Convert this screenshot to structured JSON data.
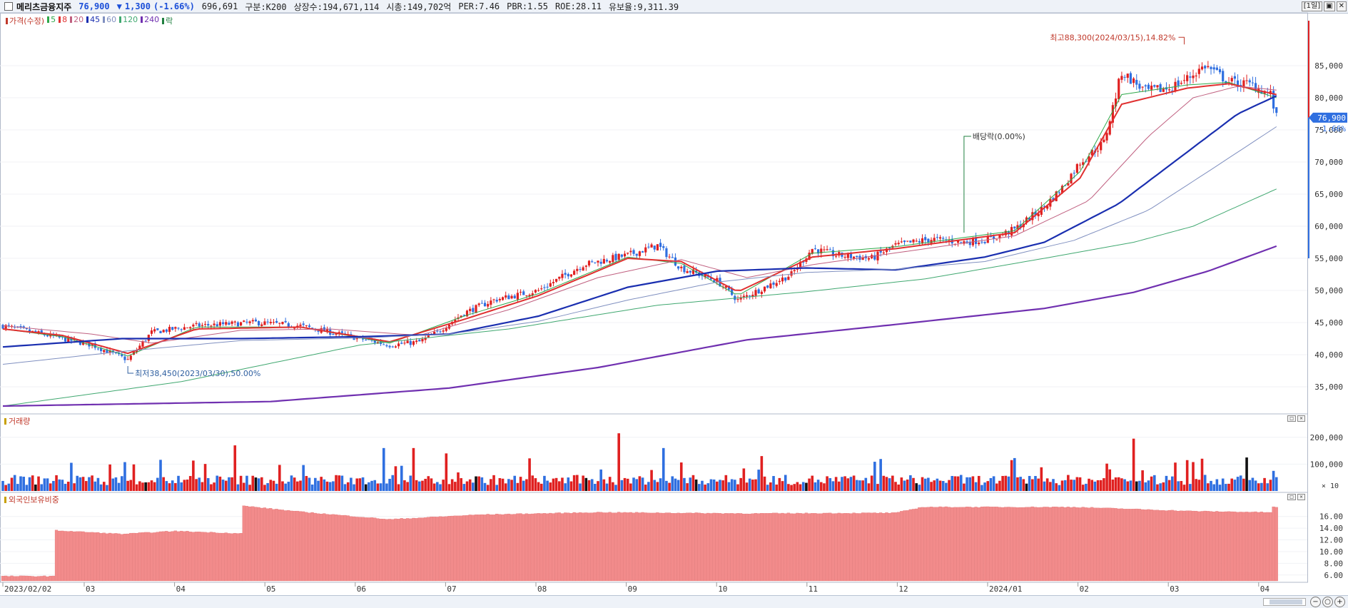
{
  "header": {
    "stock_name": "메리츠금융지주",
    "price": "76,900",
    "change_arrow": "▼",
    "change": "1,300",
    "change_pct": "(-1.66%)",
    "volume": "696,691",
    "segment": "구분:K200",
    "listed_shares": "상장수:194,671,114",
    "market_cap": "시총:149,702억",
    "per": "PER:7.46",
    "pbr": "PBR:1.55",
    "roe": "ROE:28.11",
    "reserve_ratio": "유보율:9,311.39",
    "period_button": "[1일]",
    "btn_restore": "▣",
    "btn_close": "✕"
  },
  "legend": [
    {
      "label": "가격(수정)",
      "color": "#c0392b"
    },
    {
      "label": "5",
      "color": "#2ea84a"
    },
    {
      "label": "8",
      "color": "#e03030"
    },
    {
      "label": "20",
      "color": "#c06080"
    },
    {
      "label": "45",
      "color": "#1a2fb0"
    },
    {
      "label": "60",
      "color": "#8090c0"
    },
    {
      "label": "120",
      "color": "#40a870"
    },
    {
      "label": "240",
      "color": "#7030b0"
    },
    {
      "label": "락",
      "color": "#208040"
    }
  ],
  "panels": {
    "volume_label": "거래량",
    "foreign_label": "외국인보유비중",
    "volume_unit": "× 10"
  },
  "annotations": {
    "high": "최고88,300(2024/03/15),14.82%",
    "low": "최저38,450(2023/03/30),50.00%",
    "dividend": "배당락(0.00%)",
    "last_price": "76,900",
    "last_change": "-1.66%"
  },
  "colors": {
    "up": "#e02020",
    "down": "#2f6fe0",
    "neutral": "#111111",
    "foreign_bar": "#f28b8b"
  },
  "chart_data": {
    "type": "candlestick",
    "x_tick_labels": [
      "2023/02/02",
      "03",
      "04",
      "05",
      "06",
      "07",
      "08",
      "09",
      "10",
      "11",
      "12",
      "2024/01",
      "02",
      "03",
      "04"
    ],
    "price_axis_ticks": [
      "85,000",
      "80,000",
      "75,000",
      "70,000",
      "65,000",
      "60,000",
      "55,000",
      "50,000",
      "45,000",
      "40,000",
      "35,000"
    ],
    "price_range": [
      31000,
      93000
    ],
    "volume_axis_ticks": [
      "200,000",
      "100,000"
    ],
    "volume_range": [
      0,
      250000
    ],
    "foreign_axis_ticks": [
      "16.00",
      "14.00",
      "12.00",
      "10.00",
      "8.00",
      "6.00"
    ],
    "foreign_range": [
      5.0,
      18.4
    ],
    "price_trend": [
      [
        0,
        44500
      ],
      [
        20,
        42500
      ],
      [
        30,
        41500
      ],
      [
        42,
        39200
      ],
      [
        50,
        43500
      ],
      [
        65,
        44500
      ],
      [
        85,
        45000
      ],
      [
        100,
        44500
      ],
      [
        110,
        43500
      ],
      [
        120,
        42500
      ],
      [
        130,
        41500
      ],
      [
        140,
        42000
      ],
      [
        146,
        43500
      ],
      [
        155,
        46500
      ],
      [
        165,
        48500
      ],
      [
        180,
        50000
      ],
      [
        195,
        54000
      ],
      [
        210,
        55500
      ],
      [
        220,
        57000
      ],
      [
        228,
        53500
      ],
      [
        240,
        51500
      ],
      [
        247,
        48500
      ],
      [
        256,
        50500
      ],
      [
        265,
        52500
      ],
      [
        272,
        56500
      ],
      [
        280,
        55500
      ],
      [
        292,
        55000
      ],
      [
        300,
        57000
      ],
      [
        312,
        58000
      ],
      [
        322,
        57500
      ],
      [
        332,
        58000
      ],
      [
        340,
        59500
      ],
      [
        350,
        63000
      ],
      [
        356,
        66000
      ],
      [
        362,
        70000
      ],
      [
        370,
        73000
      ],
      [
        376,
        84000
      ],
      [
        384,
        81000
      ],
      [
        392,
        81500
      ],
      [
        398,
        83000
      ],
      [
        404,
        85000
      ],
      [
        412,
        82500
      ],
      [
        420,
        82000
      ],
      [
        426,
        80500
      ],
      [
        428,
        76900
      ]
    ],
    "ma_trends": {
      "ma5": [
        [
          0,
          44000
        ],
        [
          20,
          42800
        ],
        [
          42,
          39800
        ],
        [
          65,
          44300
        ],
        [
          100,
          44300
        ],
        [
          130,
          41800
        ],
        [
          155,
          46000
        ],
        [
          180,
          49500
        ],
        [
          210,
          55200
        ],
        [
          228,
          54200
        ],
        [
          247,
          49200
        ],
        [
          272,
          55800
        ],
        [
          300,
          56800
        ],
        [
          340,
          59300
        ],
        [
          362,
          68500
        ],
        [
          376,
          80500
        ],
        [
          398,
          82000
        ],
        [
          412,
          82400
        ],
        [
          428,
          80000
        ]
      ],
      "ma8": [
        [
          0,
          44000
        ],
        [
          20,
          43000
        ],
        [
          42,
          40200
        ],
        [
          65,
          44000
        ],
        [
          100,
          44300
        ],
        [
          130,
          42000
        ],
        [
          155,
          45500
        ],
        [
          180,
          49200
        ],
        [
          210,
          55000
        ],
        [
          228,
          54500
        ],
        [
          247,
          49800
        ],
        [
          272,
          55200
        ],
        [
          300,
          56500
        ],
        [
          340,
          59000
        ],
        [
          362,
          67500
        ],
        [
          376,
          79000
        ],
        [
          398,
          81500
        ],
        [
          412,
          82200
        ],
        [
          428,
          80500
        ]
      ],
      "ma20": [
        [
          0,
          44500
        ],
        [
          30,
          43200
        ],
        [
          50,
          41800
        ],
        [
          80,
          43800
        ],
        [
          110,
          44000
        ],
        [
          140,
          43000
        ],
        [
          170,
          47000
        ],
        [
          200,
          52000
        ],
        [
          228,
          54800
        ],
        [
          250,
          52000
        ],
        [
          272,
          54000
        ],
        [
          310,
          56500
        ],
        [
          340,
          58500
        ],
        [
          365,
          64000
        ],
        [
          385,
          74000
        ],
        [
          400,
          80000
        ],
        [
          415,
          81800
        ],
        [
          428,
          81200
        ]
      ],
      "ma45": [
        [
          0,
          41200
        ],
        [
          40,
          42500
        ],
        [
          80,
          42500
        ],
        [
          120,
          42800
        ],
        [
          150,
          43200
        ],
        [
          180,
          46000
        ],
        [
          210,
          50500
        ],
        [
          240,
          53000
        ],
        [
          270,
          53500
        ],
        [
          300,
          53200
        ],
        [
          330,
          55200
        ],
        [
          350,
          57500
        ],
        [
          375,
          63500
        ],
        [
          395,
          70500
        ],
        [
          415,
          77500
        ],
        [
          428,
          80300
        ]
      ],
      "ma60": [
        [
          0,
          38500
        ],
        [
          40,
          40500
        ],
        [
          80,
          42200
        ],
        [
          120,
          42600
        ],
        [
          150,
          43200
        ],
        [
          180,
          45200
        ],
        [
          210,
          48500
        ],
        [
          240,
          51300
        ],
        [
          270,
          52800
        ],
        [
          300,
          53300
        ],
        [
          330,
          54500
        ],
        [
          360,
          57800
        ],
        [
          385,
          62500
        ],
        [
          405,
          68500
        ],
        [
          428,
          75500
        ]
      ],
      "ma120": [
        [
          0,
          32000
        ],
        [
          60,
          35800
        ],
        [
          120,
          41500
        ],
        [
          170,
          44000
        ],
        [
          220,
          47700
        ],
        [
          270,
          49800
        ],
        [
          310,
          51800
        ],
        [
          350,
          55000
        ],
        [
          380,
          57500
        ],
        [
          400,
          60000
        ],
        [
          428,
          65800
        ]
      ],
      "ma240": [
        [
          0,
          32000
        ],
        [
          90,
          32700
        ],
        [
          150,
          34800
        ],
        [
          200,
          38000
        ],
        [
          250,
          42300
        ],
        [
          300,
          44700
        ],
        [
          350,
          47200
        ],
        [
          380,
          49700
        ],
        [
          405,
          53000
        ],
        [
          428,
          56900
        ]
      ]
    },
    "foreign_trend": [
      [
        0,
        5.8
      ],
      [
        17,
        5.8
      ],
      [
        18,
        13.6
      ],
      [
        40,
        13.0
      ],
      [
        58,
        13.5
      ],
      [
        80,
        13.1
      ],
      [
        81,
        17.8
      ],
      [
        100,
        16.8
      ],
      [
        130,
        15.5
      ],
      [
        160,
        16.3
      ],
      [
        200,
        16.7
      ],
      [
        250,
        16.5
      ],
      [
        300,
        16.6
      ],
      [
        309,
        17.6
      ],
      [
        360,
        17.6
      ],
      [
        400,
        16.9
      ],
      [
        426,
        16.7
      ],
      [
        427,
        17.6
      ],
      [
        428,
        17.6
      ]
    ],
    "dividend_index": 323,
    "high_index": 397,
    "low_index": 42
  }
}
